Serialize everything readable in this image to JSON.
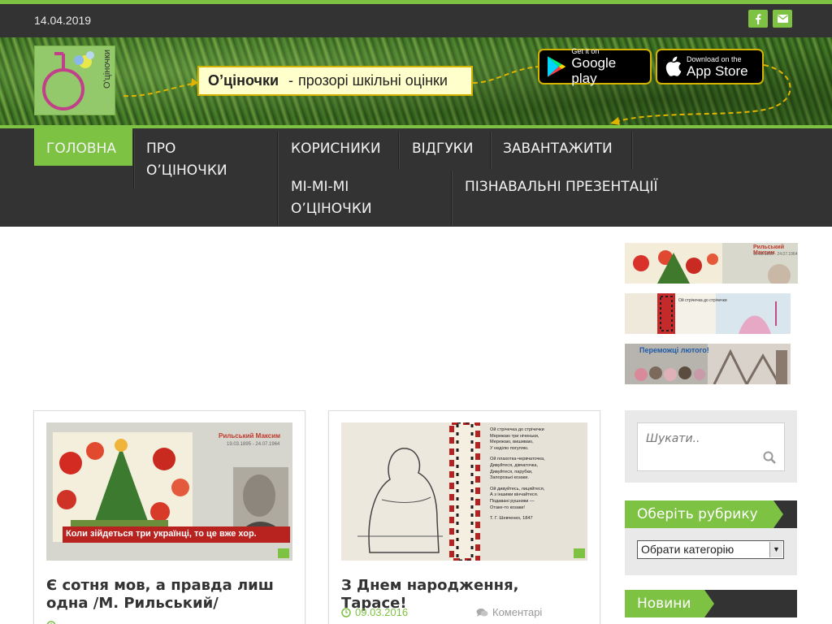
{
  "topbar": {
    "date": "14.04.2019"
  },
  "social": {
    "facebook": "facebook-icon",
    "email": "envelope-icon"
  },
  "header": {
    "logo_text": "О'цiночки",
    "tagline_brand": "О’цiночки",
    "tagline_sep": "-",
    "tagline_text": "прозорі шкільні оцінки",
    "google_small": "Get it on",
    "google_big": "Google play",
    "apple_small": "Download on the",
    "apple_big": "App Store"
  },
  "nav": {
    "items": [
      "ГОЛОВНА",
      "ПРО О’ЦІНОЧКИ",
      "КОРИСНИКИ",
      "ВІДГУКИ",
      "ЗАВАНТАЖИТИ",
      "МІ-МІ-МІ О’ЦІНОЧКИ",
      "ПІЗНАВАЛЬНІ ПРЕЗЕНТАЦІЇ"
    ],
    "item_1_line1": "ПРО",
    "item_1_line2": "О’ЦІНОЧКИ",
    "item_5_line1": "МІ-МІ-МІ",
    "item_5_line2": "О’ЦІНОЧКИ",
    "active": "ГОЛОВНА"
  },
  "posts": [
    {
      "title": "Є сотня мов, а правда лиш одна /М. Рильський/",
      "image": {
        "name": "Рильський Максим",
        "dates": "19.03.1895 - 24.07.1964",
        "quote": "Коли зійдеться три українці, то це вже хор."
      }
    },
    {
      "title": "З Днем народження, Тарасе!",
      "date": "09.03.2016",
      "comments": "Коментарі",
      "image": {
        "poem": [
          "Ой стрічечка до стрічечки",
          "Мережаю три нiченьки,",
          "Мережаю, вишиваю,",
          "У неділю погуляю.",
          "",
          "Ой плахотка-червчаточка,",
          "Дивуйтеся, дівчаточка,",
          "Дивуйтеся, парубки,",
          "Запорозькі козаки.",
          "",
          "Ой дивуйтесь, лицяйтеся,",
          "А з іншими вінчайтеся.",
          "Подавані рушники —",
          "Отаке-то козаки!"
        ],
        "signature": "Т. Г. Шевченко, 1847"
      }
    }
  ],
  "sidebar": {
    "thumbs": [
      {
        "name": "Рильський Максим",
        "dates": "19.03.1895 - 24.07.1964"
      },
      {
        "poem_hint": "Ой стрічечка до стрічечки"
      },
      {
        "caption": "Переможці лютого!"
      }
    ],
    "search_placeholder": "Шукати..",
    "category_title": "Оберіть рубрику",
    "category_select": "Обрати категорію",
    "news_title": "Новини"
  },
  "colors": {
    "accent": "#7dc242",
    "dark": "#333333",
    "tagline_border": "#d4b400",
    "tagline_bg": "#ffffcc"
  }
}
